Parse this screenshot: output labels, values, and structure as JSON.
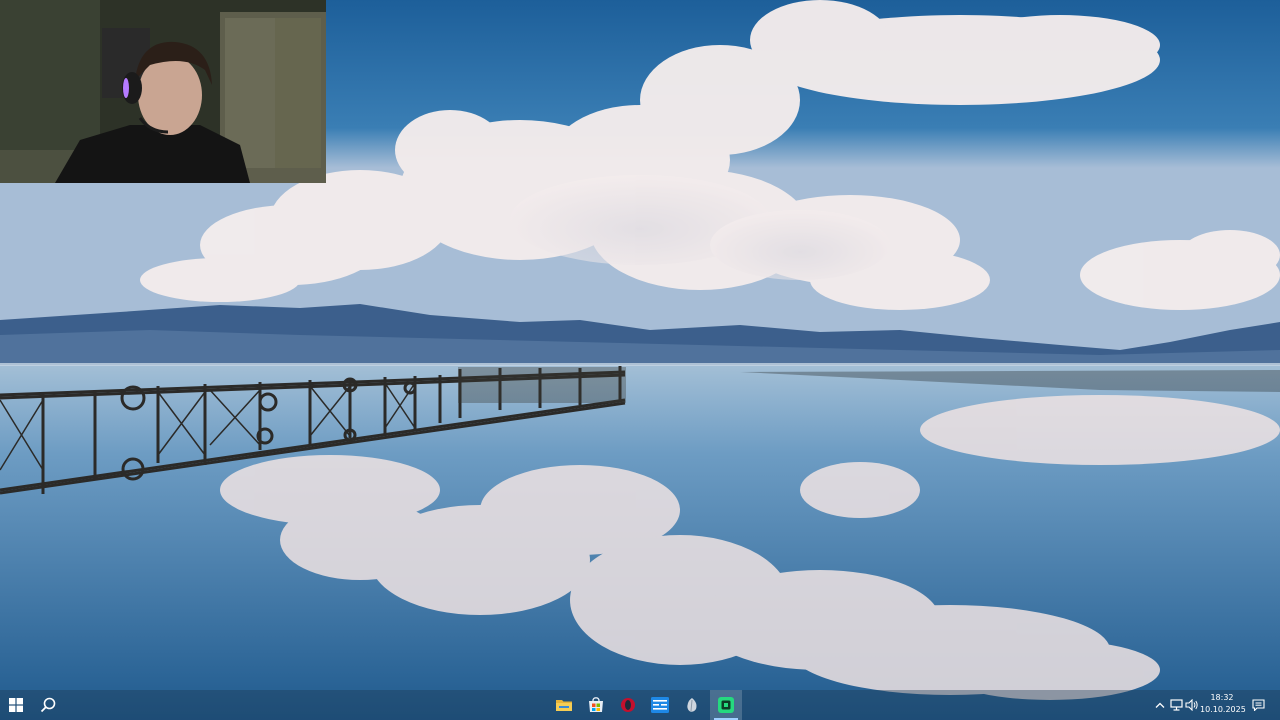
{
  "wallpaper": {
    "description_icon": "lake-pier-clouds-wallpaper"
  },
  "webcam": {
    "icon": "webcam-overlay"
  },
  "taskbar": {
    "start_icon": "windows-logo-icon",
    "search_icon": "search-icon",
    "pinned": [
      {
        "name": "file-explorer",
        "icon": "folder-icon"
      },
      {
        "name": "microsoft-store",
        "icon": "store-icon"
      },
      {
        "name": "opera-browser",
        "icon": "opera-icon"
      },
      {
        "name": "app-blue",
        "icon": "app-window-icon"
      },
      {
        "name": "app-gray",
        "icon": "leaf-icon"
      },
      {
        "name": "app-green-active",
        "icon": "green-app-icon"
      }
    ],
    "tray": {
      "chevron_icon": "chevron-up-icon",
      "network_icon": "network-icon",
      "volume_icon": "volume-icon",
      "notification_icon": "notification-icon"
    },
    "clock": {
      "time": "18:32",
      "date": "10.10.2025"
    },
    "colors": {
      "accent": "#9fd0ff",
      "taskbar": "#1e3750"
    }
  }
}
